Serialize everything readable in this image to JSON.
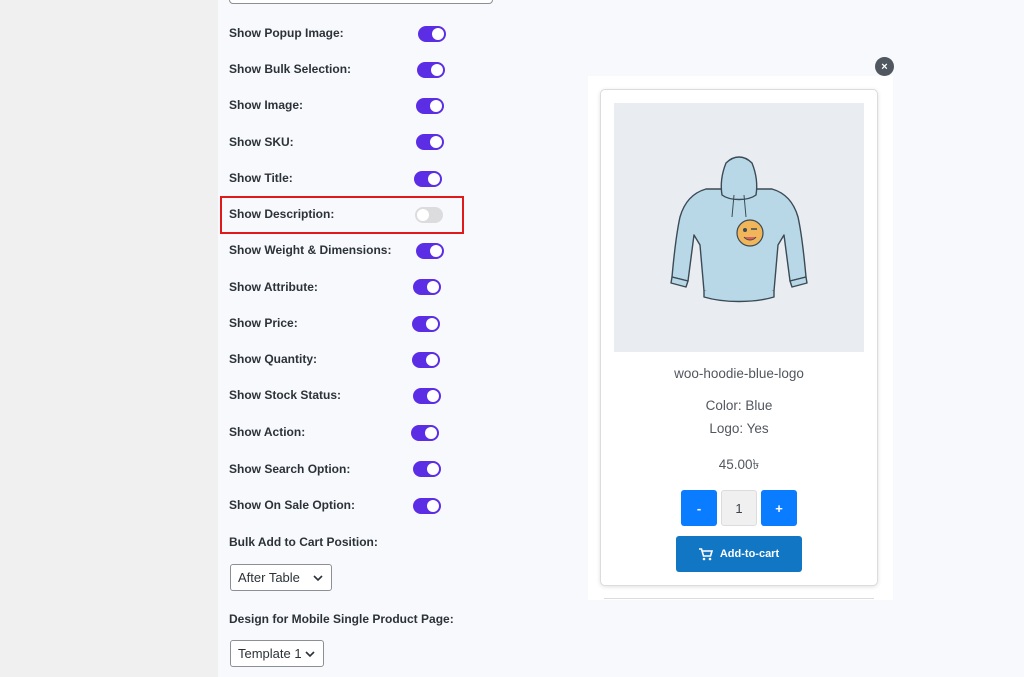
{
  "settings": {
    "toggles": [
      {
        "label": "Show Popup Image:",
        "on": true
      },
      {
        "label": "Show Bulk Selection:",
        "on": true
      },
      {
        "label": "Show Image:",
        "on": true
      },
      {
        "label": "Show SKU:",
        "on": true
      },
      {
        "label": "Show Title:",
        "on": true
      },
      {
        "label": "Show Description:",
        "on": false
      },
      {
        "label": "Show Weight & Dimensions:",
        "on": true
      },
      {
        "label": "Show Attribute:",
        "on": true
      },
      {
        "label": "Show Price:",
        "on": true
      },
      {
        "label": "Show Quantity:",
        "on": true
      },
      {
        "label": "Show Stock Status:",
        "on": true
      },
      {
        "label": "Show Action:",
        "on": true
      },
      {
        "label": "Show Search Option:",
        "on": true
      },
      {
        "label": "Show On Sale Option:",
        "on": true
      }
    ],
    "bulk_position_label": "Bulk Add to Cart Position:",
    "bulk_position_value": "After Table",
    "mobile_design_label": "Design for Mobile Single Product Page:",
    "mobile_design_value": "Template 1"
  },
  "preview": {
    "close_icon": "×",
    "product_name": "woo-hoodie-blue-logo",
    "color": "Color: Blue",
    "logo": "Logo: Yes",
    "price": "45.00৳",
    "qty_minus": "-",
    "qty_value": "1",
    "qty_plus": "+",
    "add_to_cart": "Add-to-cart"
  },
  "colors": {
    "toggle_on": "#5b2ee6",
    "toggle_off": "#dcdcde",
    "highlight": "#e0191b",
    "qty_button": "#0a7cff",
    "cart_button": "#1177c4"
  }
}
